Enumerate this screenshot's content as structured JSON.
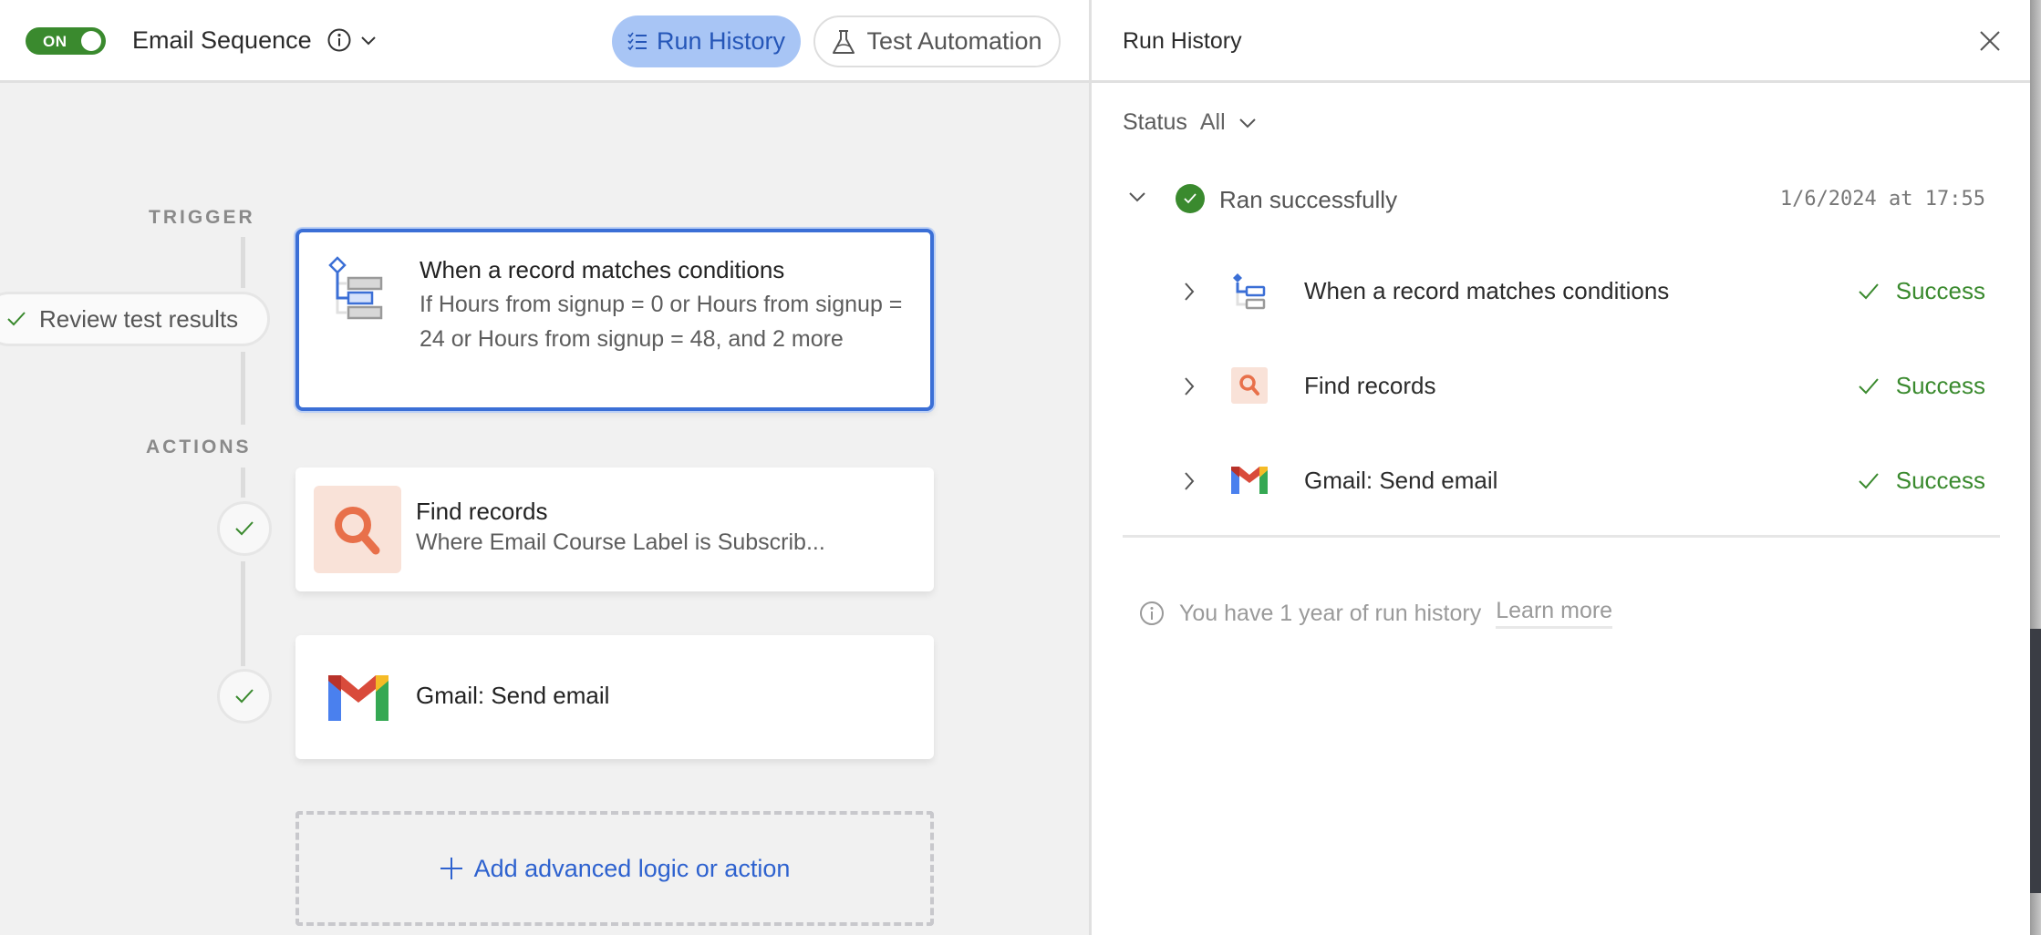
{
  "topbar": {
    "toggle_label": "ON",
    "workflow_title": "Email Sequence",
    "run_history_button": "Run History",
    "test_automation_button": "Test Automation"
  },
  "canvas": {
    "trigger_label": "TRIGGER",
    "actions_label": "ACTIONS",
    "review_pill": "Review test results",
    "trigger_card": {
      "title": "When a record matches conditions",
      "subtitle": "If Hours from signup = 0 or Hours from signup = 24 or Hours from signup = 48, and 2 more",
      "icon": "conditions-icon"
    },
    "actions": [
      {
        "title": "Find records",
        "subtitle": "Where Email Course Label is Subscrib...",
        "icon": "search-icon",
        "status": "check"
      },
      {
        "title": "Gmail: Send email",
        "subtitle": "",
        "icon": "gmail-icon",
        "status": "check"
      }
    ],
    "add_button": "Add advanced logic or action"
  },
  "panel": {
    "title": "Run History",
    "status_label": "Status",
    "status_value": "All",
    "run": {
      "label": "Ran successfully",
      "timestamp": "1/6/2024 at 17:55",
      "expanded": true
    },
    "steps": [
      {
        "name": "When a record matches conditions",
        "status": "Success",
        "icon": "conditions-icon"
      },
      {
        "name": "Find records",
        "status": "Success",
        "icon": "search-icon"
      },
      {
        "name": "Gmail: Send email",
        "status": "Success",
        "icon": "gmail-icon"
      }
    ],
    "note": "You have 1 year of run history",
    "learn_more": "Learn more"
  },
  "colors": {
    "accent_blue": "#3b6fd6",
    "success_green": "#3a8a2e",
    "run_history_bg": "#a8c5f5",
    "find_icon_bg": "#f9e2d8",
    "find_icon_fg": "#e8704a"
  }
}
